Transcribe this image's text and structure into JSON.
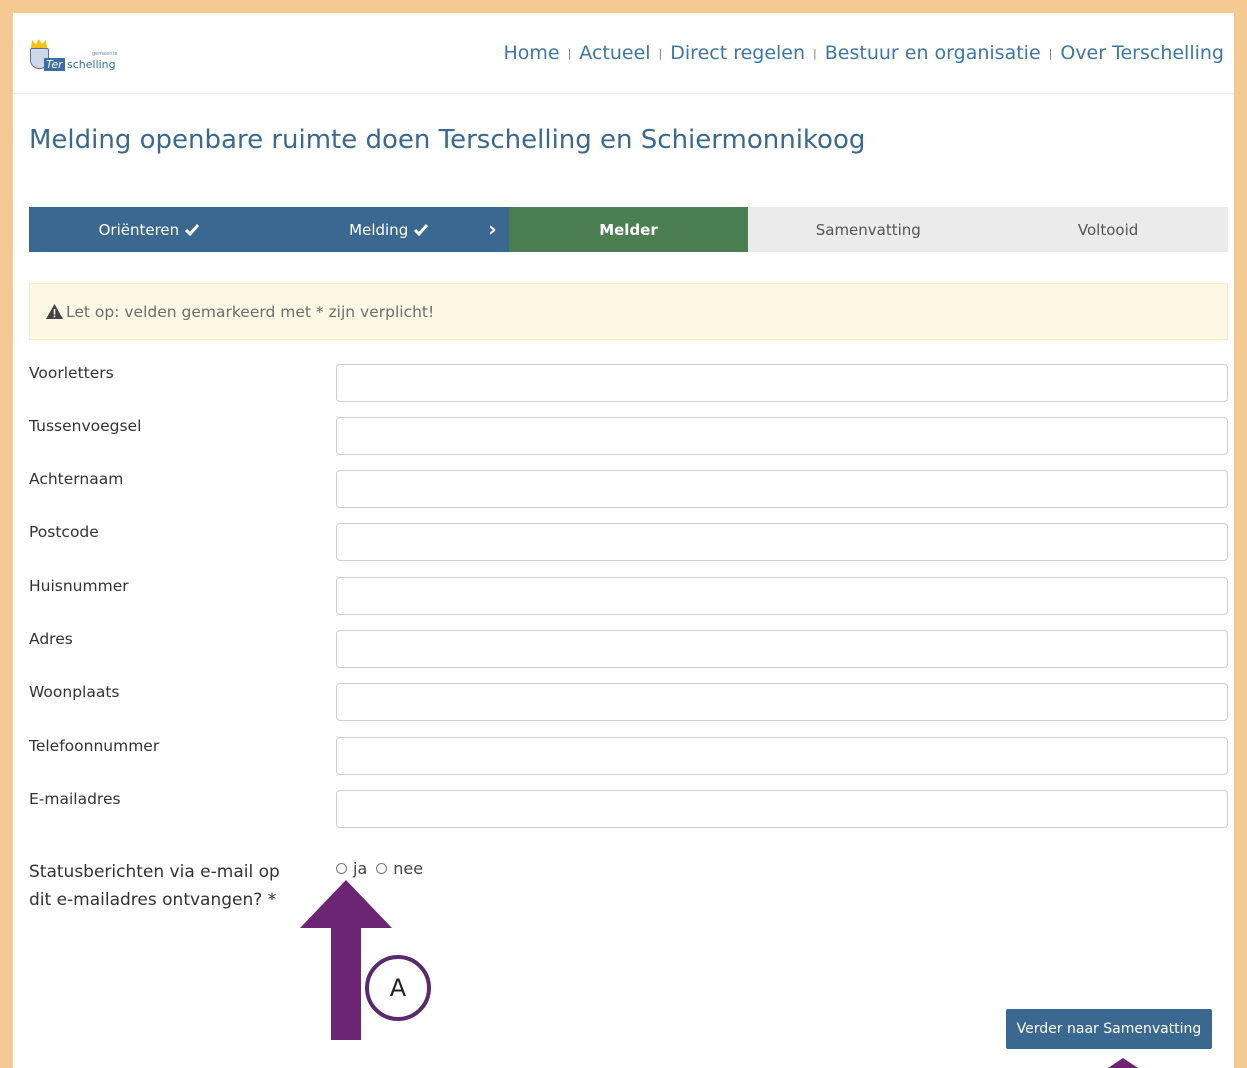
{
  "header": {
    "logo": {
      "text_prefix": "Ter",
      "text_suffix": "schelling",
      "small_text": "gemeente"
    },
    "nav": [
      "Home",
      "Actueel",
      "Direct regelen",
      "Bestuur en organisatie",
      "Over Terschelling"
    ]
  },
  "page_title": "Melding openbare ruimte doen Terschelling en Schiermonnikoog",
  "steps": [
    {
      "label": "Oriënteren",
      "state": "completed"
    },
    {
      "label": "Melding",
      "state": "completed"
    },
    {
      "label": "Melder",
      "state": "current"
    },
    {
      "label": "Samenvatting",
      "state": "upcoming"
    },
    {
      "label": "Voltooid",
      "state": "upcoming"
    }
  ],
  "alert": {
    "text": "Let op: velden gemarkeerd met * zijn verplicht!",
    "icon": "warning-triangle-icon"
  },
  "form": {
    "fields": [
      {
        "label": "Voorletters",
        "value": ""
      },
      {
        "label": "Tussenvoegsel",
        "value": ""
      },
      {
        "label": "Achternaam",
        "value": ""
      },
      {
        "label": "Postcode",
        "value": ""
      },
      {
        "label": "Huisnummer",
        "value": ""
      },
      {
        "label": "Adres",
        "value": ""
      },
      {
        "label": "Woonplaats",
        "value": ""
      },
      {
        "label": "Telefoonnummer",
        "value": ""
      },
      {
        "label": "E-mailadres",
        "value": ""
      }
    ],
    "status_question": "Statusberichten via e-mail op dit e-mailadres ontvangen? *",
    "status_options": [
      "ja",
      "nee"
    ]
  },
  "next_button": "Verder naar Samenvatting",
  "annotation": {
    "label": "A"
  },
  "colors": {
    "frame": "#f5c992",
    "step_done": "#3b6891",
    "step_current": "#4b7e50",
    "step_todo": "#ebebeb",
    "annotation": "#6b2572",
    "link": "#3d77a8"
  }
}
